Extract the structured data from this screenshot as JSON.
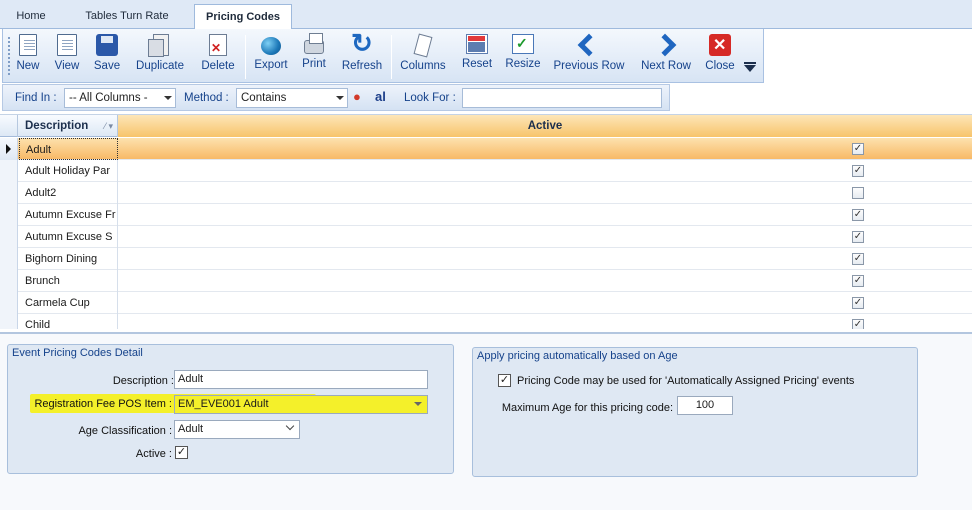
{
  "tabs": [
    {
      "label": "Home",
      "active": false
    },
    {
      "label": "Tables Turn Rate",
      "active": false
    },
    {
      "label": "Pricing Codes",
      "active": true
    }
  ],
  "toolbar": {
    "buttons": [
      {
        "label": "New",
        "icon": "new-document-icon"
      },
      {
        "label": "View",
        "icon": "view-document-icon"
      },
      {
        "label": "Save",
        "icon": "save-disk-icon"
      },
      {
        "label": "Duplicate",
        "icon": "duplicate-icon"
      },
      {
        "label": "Delete",
        "icon": "delete-icon"
      },
      {
        "label": "Export",
        "icon": "export-icon"
      },
      {
        "label": "Print",
        "icon": "printer-icon"
      },
      {
        "label": "Refresh",
        "icon": "refresh-icon"
      },
      {
        "label": "Columns",
        "icon": "columns-icon"
      },
      {
        "label": "Reset",
        "icon": "reset-icon"
      },
      {
        "label": "Resize",
        "icon": "resize-icon"
      },
      {
        "label": "Previous Row",
        "icon": "chevron-left-icon"
      },
      {
        "label": "Next Row",
        "icon": "chevron-right-icon"
      },
      {
        "label": "Close",
        "icon": "close-icon"
      }
    ]
  },
  "findbar": {
    "find_in_label": "Find In :",
    "find_in_value": "-- All Columns -",
    "method_label": "Method :",
    "method_value": "Contains",
    "look_for_label": "Look For :",
    "look_for_value": "",
    "icon_text": "al"
  },
  "grid": {
    "columns": [
      "Description",
      "Active"
    ],
    "rows": [
      {
        "description": "Adult",
        "active": true,
        "current": true
      },
      {
        "description": "Adult Holiday Par",
        "active": true,
        "current": false
      },
      {
        "description": "Adult2",
        "active": false,
        "current": false
      },
      {
        "description": "Autumn Excuse Fr",
        "active": true,
        "current": false
      },
      {
        "description": "Autumn Excuse S",
        "active": true,
        "current": false
      },
      {
        "description": "Bighorn Dining",
        "active": true,
        "current": false
      },
      {
        "description": "Brunch",
        "active": true,
        "current": false
      },
      {
        "description": "Carmela Cup",
        "active": true,
        "current": false
      },
      {
        "description": "Child",
        "active": true,
        "current": false
      }
    ],
    "check_glyph": "✓"
  },
  "detail": {
    "title": "Event Pricing Codes Detail",
    "description_label": "Description :",
    "description_value": "Adult",
    "pos_item_label": "Registration Fee POS Item :",
    "pos_item_value": "EM_EVE001 Adult",
    "age_class_label": "Age Classification :",
    "age_class_value": "Adult",
    "active_label": "Active :",
    "active_checked": true
  },
  "auto_pricing": {
    "title": "Apply pricing automatically based on Age",
    "checkbox_label": "Pricing Code may be used for 'Automatically Assigned Pricing' events",
    "checkbox_checked": true,
    "max_age_label": "Maximum Age for this pricing code:",
    "max_age_value": "100"
  },
  "colors": {
    "accent": "#15428b",
    "current_row": "#f8b967",
    "highlight": "#f4f02a"
  }
}
